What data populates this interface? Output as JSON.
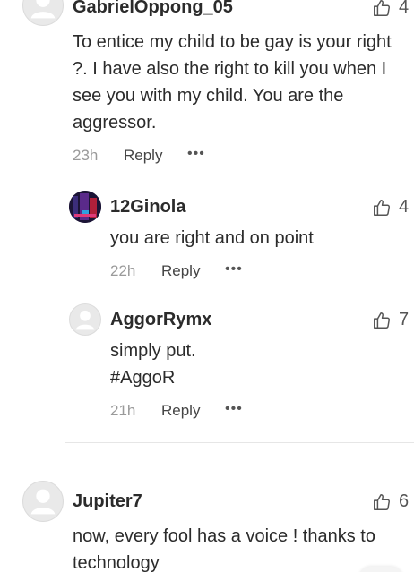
{
  "comments": [
    {
      "username": "GabrielOppong_05",
      "text": "To entice my child to be gay is your right ?. I have also the right to kill you when I see you with my child. You are the aggressor.",
      "time": "23h",
      "reply_label": "Reply",
      "more_label": "•••",
      "likes": "4",
      "replies": [
        {
          "username": "12Ginola",
          "text": "you are right and on point",
          "time": "22h",
          "reply_label": "Reply",
          "more_label": "•••",
          "likes": "4"
        },
        {
          "username": "AggorRymx",
          "text_line1": "simply put.",
          "text_line2": "#AggoR",
          "time": "21h",
          "reply_label": "Reply",
          "more_label": "•••",
          "likes": "7"
        }
      ]
    },
    {
      "username": "Jupiter7",
      "text": "now, every fool has a voice ! thanks to technology",
      "likes": "6"
    }
  ],
  "icons": {
    "like": "thumbs-up-icon",
    "more": "more-options-icon",
    "avatar_default": "default-avatar-icon"
  },
  "colors": {
    "text": "#2b2b2b",
    "meta": "#9a9a9a",
    "divider": "#e6e6e6"
  }
}
